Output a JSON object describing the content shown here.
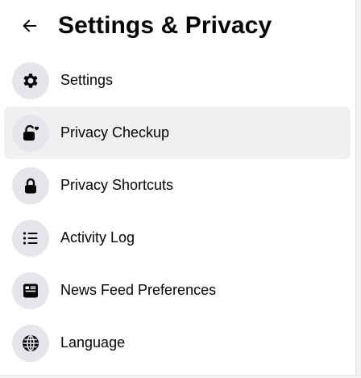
{
  "header": {
    "title": "Settings & Privacy",
    "back_icon": "back-arrow-icon"
  },
  "menu": {
    "items": [
      {
        "label": "Settings",
        "icon": "gear-icon",
        "active": false
      },
      {
        "label": "Privacy Checkup",
        "icon": "lock-heart-icon",
        "active": true
      },
      {
        "label": "Privacy Shortcuts",
        "icon": "lock-icon",
        "active": false
      },
      {
        "label": "Activity Log",
        "icon": "list-icon",
        "active": false
      },
      {
        "label": "News Feed Preferences",
        "icon": "news-feed-icon",
        "active": false
      },
      {
        "label": "Language",
        "icon": "globe-icon",
        "active": false
      }
    ]
  },
  "colors": {
    "text": "#050505",
    "icon_bg": "#e4e6eb",
    "active_bg": "#f0f0f0"
  }
}
